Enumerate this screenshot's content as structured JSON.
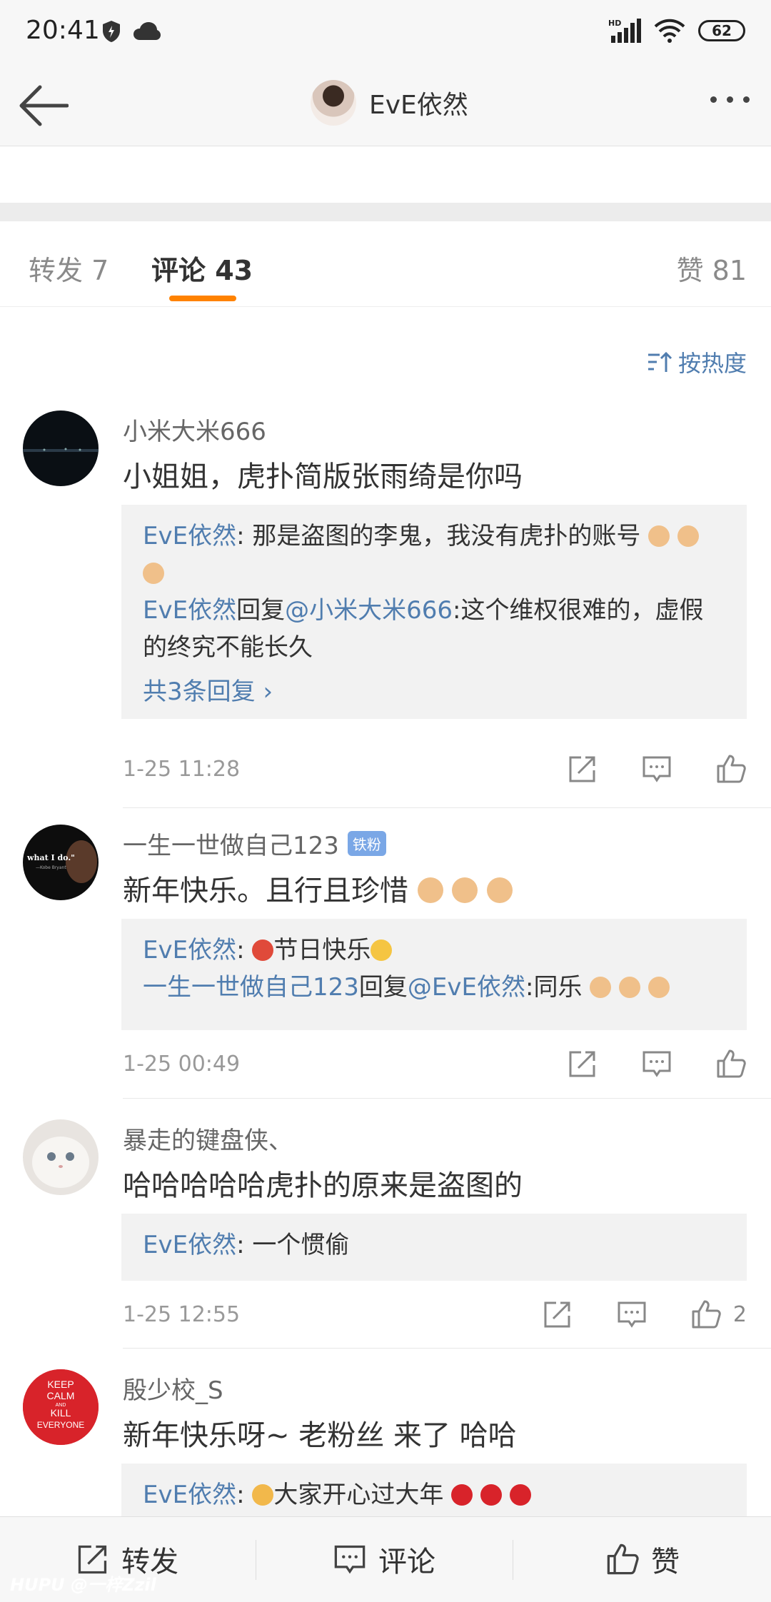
{
  "status_bar": {
    "time": "20:41",
    "battery": "62",
    "hd": "HD"
  },
  "nav": {
    "title": "EvE依然"
  },
  "tabs": [
    {
      "label": "转发 7"
    },
    {
      "label": "评论 43"
    },
    {
      "label": "赞 81"
    }
  ],
  "sort": {
    "label": "按热度"
  },
  "comments": [
    {
      "user": "小米大米666",
      "text": "小姐姐，虎扑简版张雨绮是你吗",
      "replies": [
        {
          "name": "EvE依然",
          "sep": ": ",
          "content": "那是盗图的李鬼，我没有虎扑的账号"
        },
        {
          "name": "EvE依然",
          "mid": "回复",
          "at": "@小米大米666",
          "content": ":这个维权很难的，虚假的终究不能长久"
        }
      ],
      "more": "共3条回复",
      "time": "1-25 11:28"
    },
    {
      "user": "一生一世做自己123",
      "badge": "铁粉",
      "text": "新年快乐。且行且珍惜",
      "replies": [
        {
          "name": "EvE依然",
          "sep": ": ",
          "content": "节日快乐"
        },
        {
          "name": "一生一世做自己123",
          "mid": "回复",
          "at": "@EvE依然",
          "content": ":同乐"
        }
      ],
      "time": "1-25 00:49"
    },
    {
      "user": "暴走的键盘侠、",
      "text": "哈哈哈哈哈虎扑的原来是盗图的",
      "replies": [
        {
          "name": "EvE依然",
          "sep": ": ",
          "content": "一个惯偷"
        }
      ],
      "time": "1-25 12:55",
      "likes": "2"
    },
    {
      "user": "殷少校_S",
      "text": "新年快乐呀~  老粉丝 来了 哈哈",
      "replies": [
        {
          "name": "EvE依然",
          "sep": ": ",
          "content": "大家开心过大年"
        }
      ],
      "avatar_text": [
        "KEEP",
        "CALM",
        "AND",
        "KILL",
        "EVERYONE"
      ]
    }
  ],
  "bottom_bar": {
    "repost": "转发",
    "comment": "评论",
    "like": "赞"
  },
  "watermark": "HUPU @一梓Zzil",
  "colors": {
    "accent": "#ff8200",
    "link": "#507daf"
  }
}
